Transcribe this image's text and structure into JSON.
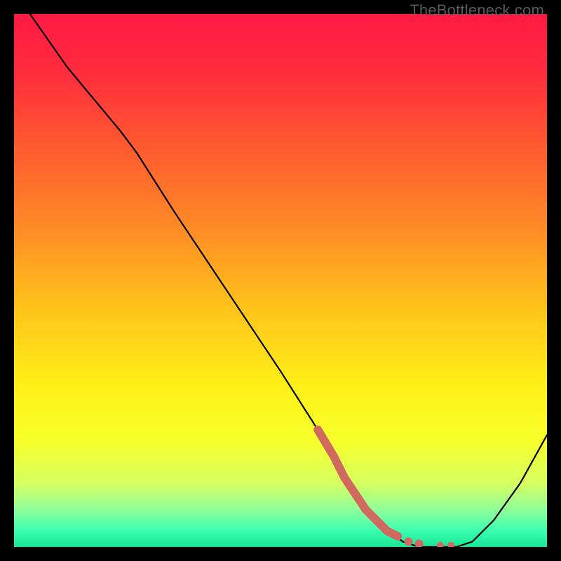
{
  "watermark": "TheBottleneck.com",
  "gradient_stops": [
    {
      "offset": 0.0,
      "color": "#ff1a44"
    },
    {
      "offset": 0.1,
      "color": "#ff2a3e"
    },
    {
      "offset": 0.25,
      "color": "#ff5a30"
    },
    {
      "offset": 0.4,
      "color": "#ff8a26"
    },
    {
      "offset": 0.55,
      "color": "#ffc31a"
    },
    {
      "offset": 0.7,
      "color": "#fff018"
    },
    {
      "offset": 0.8,
      "color": "#f7ff2a"
    },
    {
      "offset": 0.88,
      "color": "#d7ff60"
    },
    {
      "offset": 0.93,
      "color": "#8fff9a"
    },
    {
      "offset": 0.97,
      "color": "#3affb0"
    },
    {
      "offset": 1.0,
      "color": "#18e597"
    }
  ],
  "chart_data": {
    "type": "line",
    "title": "",
    "xlabel": "",
    "ylabel": "",
    "xlim": [
      0,
      100
    ],
    "ylim": [
      0,
      100
    ],
    "grid": false,
    "series": [
      {
        "name": "bottleneck-curve",
        "color": "#000000",
        "x": [
          3,
          10,
          20,
          23,
          30,
          40,
          50,
          57,
          62,
          66,
          70,
          73,
          76,
          80,
          83,
          86,
          90,
          95,
          100
        ],
        "y": [
          100,
          90,
          78,
          74,
          63,
          48,
          33,
          22,
          13,
          7,
          3,
          1,
          0,
          0,
          0,
          1,
          5,
          12,
          21
        ]
      },
      {
        "name": "highlight-segment",
        "color": "#d06a60",
        "thick": true,
        "x": [
          57,
          60,
          62,
          64,
          66,
          68,
          70,
          72,
          74,
          76,
          78,
          80,
          82
        ],
        "y": [
          22,
          17,
          13,
          10,
          7,
          5,
          3,
          2,
          1,
          0.6,
          0.4,
          0.3,
          0.3
        ]
      }
    ],
    "annotations": []
  }
}
